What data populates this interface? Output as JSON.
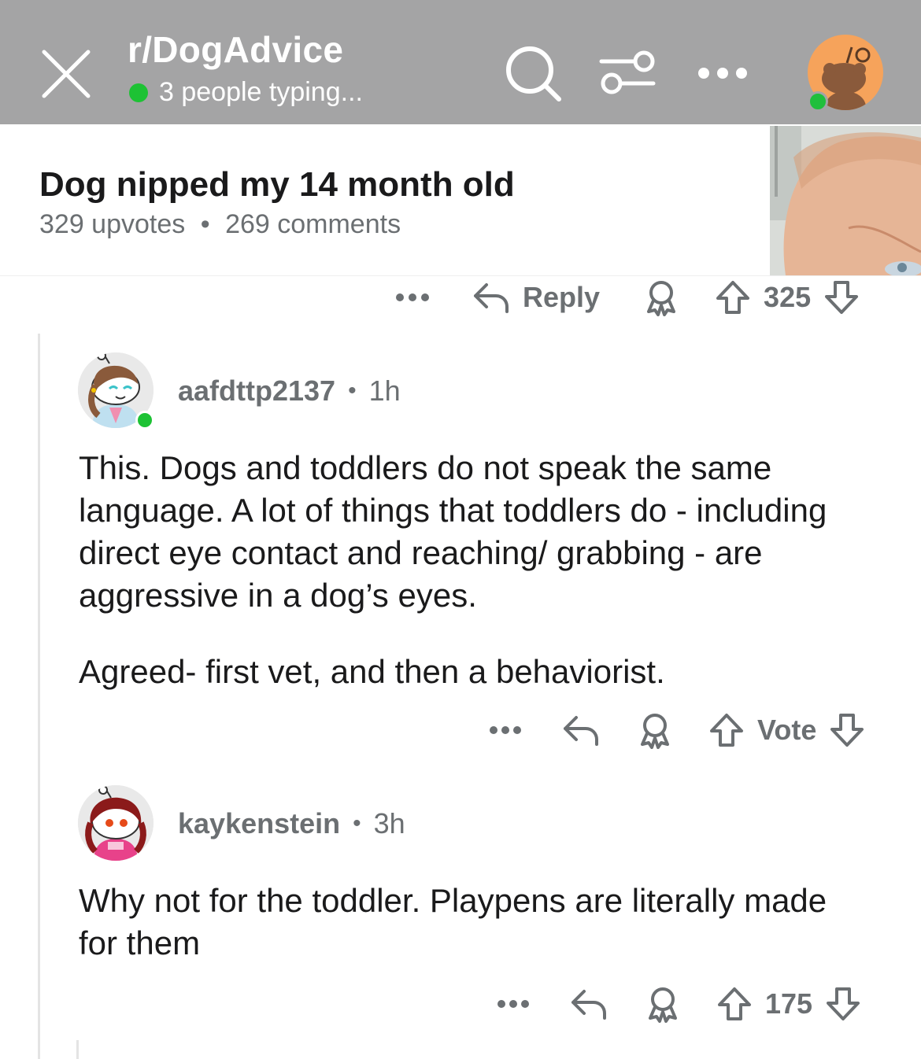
{
  "header": {
    "subreddit": "r/DogAdvice",
    "typing_status": "3 people typing..."
  },
  "post": {
    "title": "Dog nipped my 14 month old",
    "upvotes": "329 upvotes",
    "separator": "•",
    "comments": "269 comments"
  },
  "parent_actions": {
    "reply_label": "Reply",
    "score": "325"
  },
  "comments": [
    {
      "username": "aafdttp2137",
      "separator": "•",
      "age": "1h",
      "paragraphs": [
        "This. Dogs and toddlers do not speak the same language. A lot of things that toddlers do - including direct eye contact and reaching/ grabbing - are aggressive in a dog’s eyes.",
        "Agreed- first vet, and then a behaviorist."
      ],
      "score": "Vote"
    },
    {
      "username": "kaykenstein",
      "separator": "•",
      "age": "3h",
      "paragraphs": [
        "Why not for the toddler. Playpens are literally made for them"
      ],
      "score": "175"
    }
  ],
  "colors": {
    "header_bg": "#a4a4a5",
    "online_green": "#1dc234",
    "meta_gray": "#6b6f72",
    "avatar_orange": "#f6a35b"
  }
}
